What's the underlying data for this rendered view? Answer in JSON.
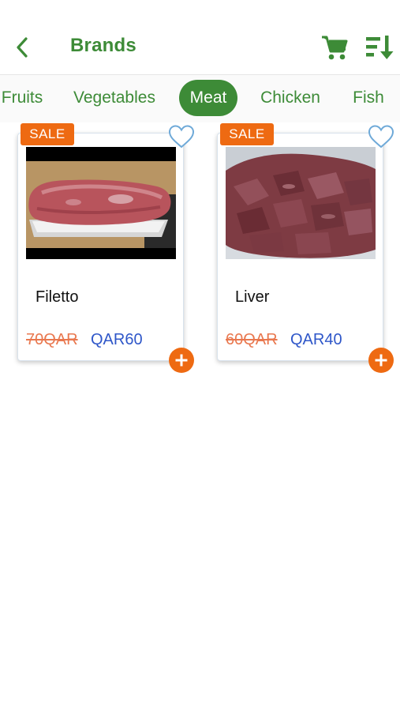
{
  "header": {
    "title": "Brands",
    "back_icon": "chevron-left-icon",
    "cart_icon": "cart-icon",
    "sort_icon": "sort-icon",
    "accent_color": "#3d8b37"
  },
  "tabs": [
    {
      "label": "Fruits",
      "active": false
    },
    {
      "label": "Vegetables",
      "active": false
    },
    {
      "label": "Meat",
      "active": true
    },
    {
      "label": "Chicken",
      "active": false
    },
    {
      "label": "Fish",
      "active": false
    }
  ],
  "products": [
    {
      "badge": "SALE",
      "name": "Filetto",
      "old_price": "70QAR",
      "new_price": "QAR60",
      "favorite": false
    },
    {
      "badge": "SALE",
      "name": "Liver",
      "old_price": "60QAR",
      "new_price": "QAR40",
      "favorite": false
    }
  ],
  "colors": {
    "sale_badge": "#ee6a12",
    "old_price": "#e9784f",
    "new_price": "#2f57c9",
    "add_button": "#ee6a12"
  }
}
